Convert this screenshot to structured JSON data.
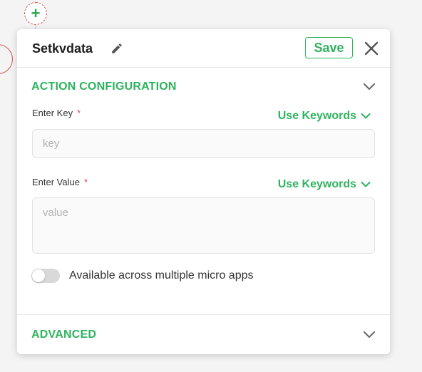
{
  "canvas": {
    "add_node_symbol": "+"
  },
  "panel": {
    "title": "Setkvdata",
    "save_label": "Save"
  },
  "action_config": {
    "heading": "ACTION CONFIGURATION",
    "key": {
      "label": "Enter Key",
      "required_mark": "*",
      "keywords_label": "Use Keywords",
      "value": "",
      "placeholder": "key"
    },
    "value": {
      "label": "Enter Value",
      "required_mark": "*",
      "keywords_label": "Use Keywords",
      "value": "",
      "placeholder": "value"
    },
    "toggle": {
      "label": "Available across multiple micro apps",
      "on": false
    }
  },
  "advanced": {
    "heading": "ADVANCED"
  },
  "colors": {
    "accent": "#2eb35e",
    "required": "#e0443e",
    "node_border": "#d9534f"
  },
  "icons": [
    "plus-icon",
    "pencil-icon",
    "close-icon",
    "chevron-down-icon"
  ]
}
